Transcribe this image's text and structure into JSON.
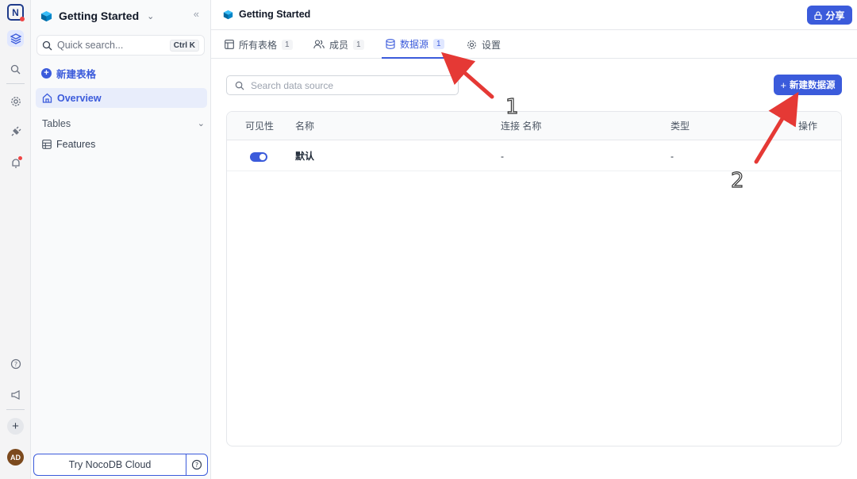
{
  "rail": {
    "logo_letter": "N",
    "icons": [
      "base-icon",
      "search-icon",
      "settings-icon",
      "plug-icon",
      "bell-icon",
      "help-icon",
      "megaphone-icon"
    ],
    "add_label": "+",
    "avatar": "AD"
  },
  "sidebar": {
    "workspace_title": "Getting Started",
    "quick_search_placeholder": "Quick search...",
    "quick_search_shortcut": "Ctrl K",
    "new_table": "新建表格",
    "overview": "Overview",
    "tables_header": "Tables",
    "tables": [
      "Features"
    ],
    "cloud_button": "Try NocoDB Cloud"
  },
  "header": {
    "title": "Getting Started",
    "share": "分享"
  },
  "tabs": [
    {
      "label": "所有表格",
      "count": "1"
    },
    {
      "label": "成员",
      "count": "1"
    },
    {
      "label": "数据源",
      "count": "1",
      "active": true
    },
    {
      "label": "设置"
    }
  ],
  "datasource": {
    "search_placeholder": "Search data source",
    "new_button": "新建数据源",
    "columns": [
      "可见性",
      "名称",
      "连接 名称",
      "类型",
      "操作"
    ],
    "rows": [
      {
        "visible": true,
        "name": "默认",
        "connection": "-",
        "type": "-"
      }
    ]
  },
  "annotations": {
    "marker_1": "1",
    "marker_2": "2"
  },
  "colors": {
    "accent": "#3b5bdb",
    "arrow": "#e53935"
  }
}
